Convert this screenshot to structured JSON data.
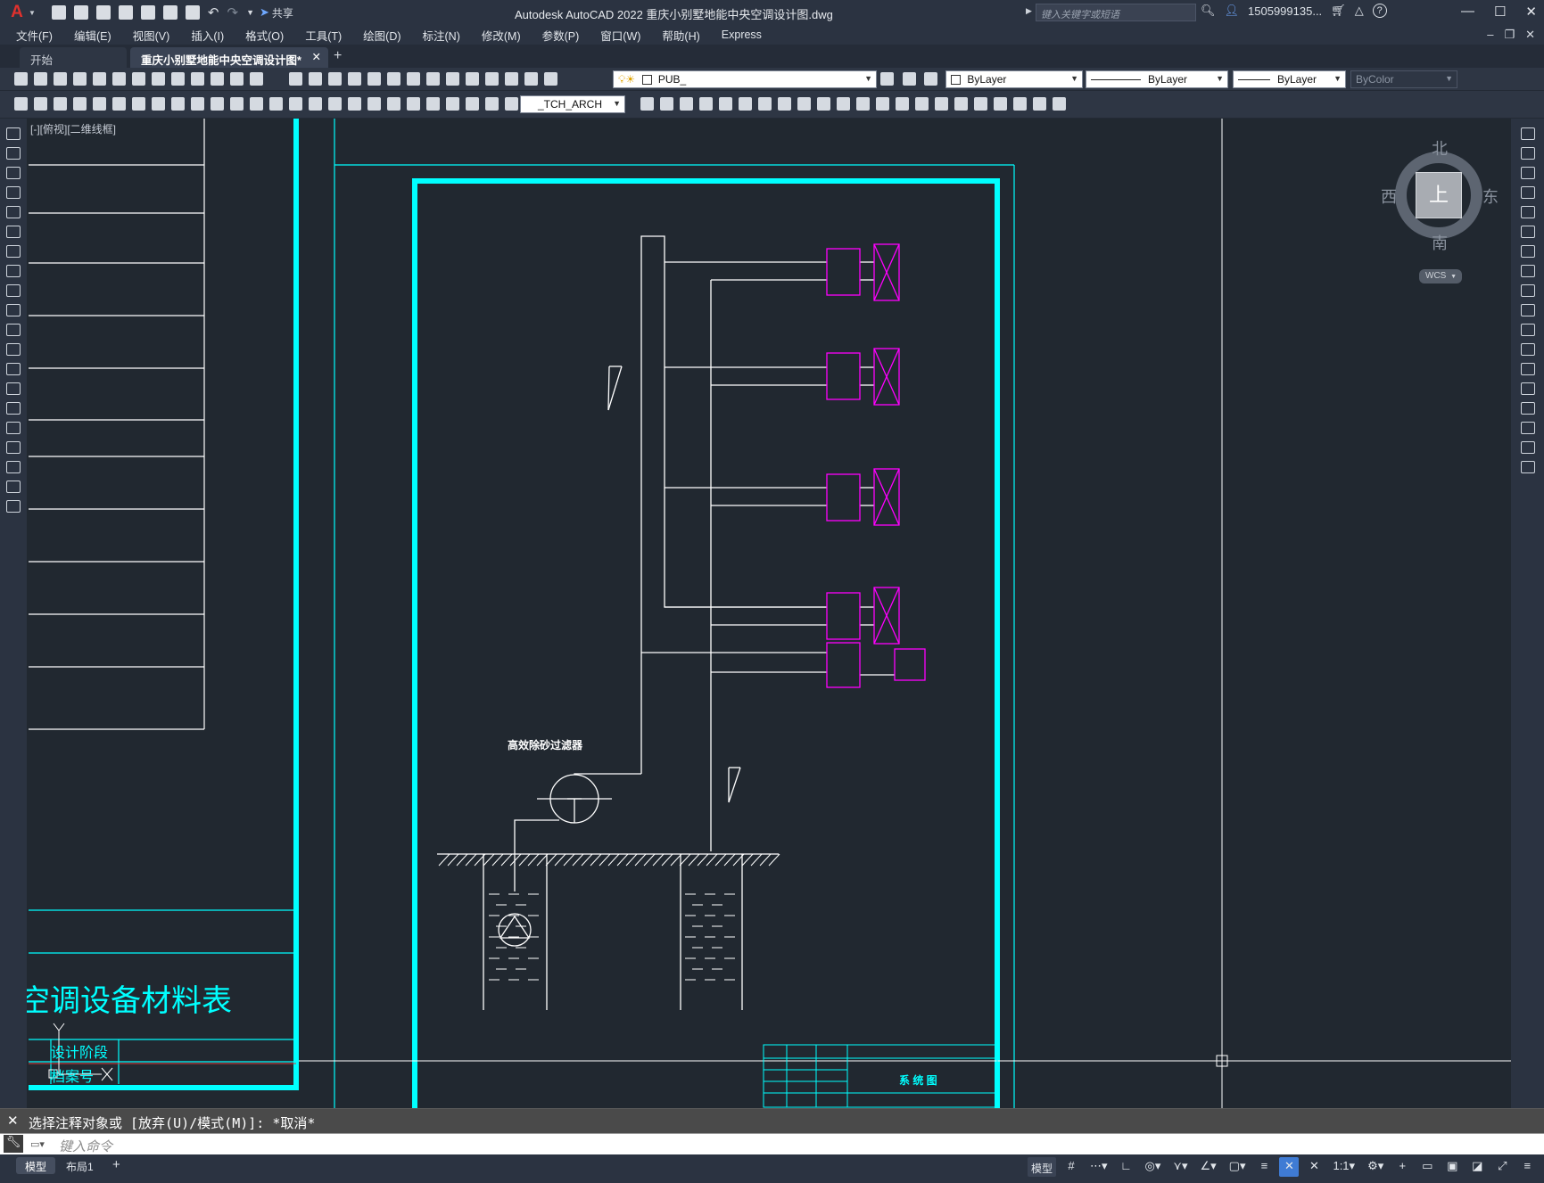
{
  "titlebar": {
    "app_logo": "A",
    "share_label": "共享",
    "title": "Autodesk AutoCAD 2022    重庆小别墅地能中央空调设计图.dwg",
    "search_placeholder": "键入关键字或短语",
    "user": "1505999135...",
    "help": "?"
  },
  "menu": [
    "文件(F)",
    "编辑(E)",
    "视图(V)",
    "插入(I)",
    "格式(O)",
    "工具(T)",
    "绘图(D)",
    "标注(N)",
    "修改(M)",
    "参数(P)",
    "窗口(W)",
    "帮助(H)",
    "Express"
  ],
  "tabs": [
    {
      "label": "开始",
      "active": false
    },
    {
      "label": "重庆小别墅地能中央空调设计图*",
      "active": true
    }
  ],
  "toolbar": {
    "layer_value": "PUB_",
    "color_value": "ByLayer",
    "linetype_value": "ByLayer",
    "lineweight_value": "ByLayer",
    "plotstyle_value": "ByColor",
    "textstyle_value": "_TCH_ARCH"
  },
  "viewport": {
    "label": "[-][俯视][二维线框]"
  },
  "viewcube": {
    "north": "北",
    "south": "南",
    "east": "东",
    "west": "西",
    "face": "上",
    "ucs": "WCS"
  },
  "drawing": {
    "table_title": "空调设备材料表",
    "design_stage": "设计阶段",
    "file_no": "档案号",
    "filter_label": "高效除砂过滤器",
    "system_title": "系 统 图",
    "colors": {
      "background": "#212830",
      "line": "#ffffff",
      "frame": "#00ffff",
      "equipment": "#ff00ff"
    }
  },
  "command": {
    "history": "选择注释对象或 [放弃(U)/模式(M)]: *取消*",
    "placeholder": "键入命令"
  },
  "status": {
    "layouts": [
      {
        "label": "模型",
        "active": true
      },
      {
        "label": "布局1",
        "active": false
      }
    ],
    "model_label": "模型",
    "scale": "1:1"
  }
}
